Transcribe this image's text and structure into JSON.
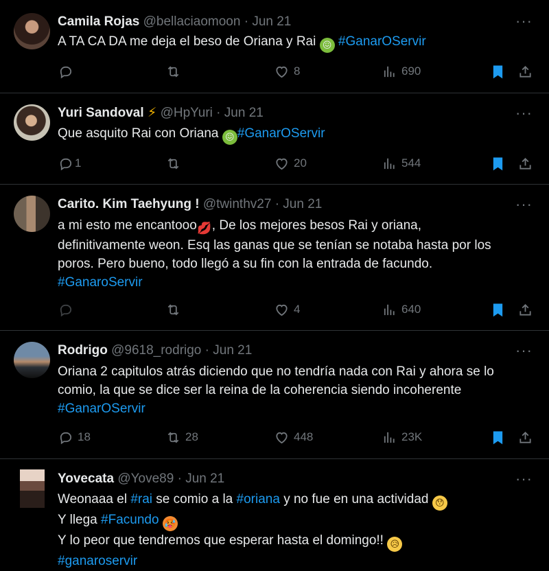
{
  "tweets": [
    {
      "name": "Camila Rojas",
      "badge": "",
      "handle": "@bellaciaomoon",
      "dot": "·",
      "date": "Jun 21",
      "text_a": "A TA CA DA me deja el beso de Oriana y Rai",
      "emoji_a": "nauseated-face",
      "tag_a": "#GanarOServir",
      "replies": "",
      "retweets": "",
      "likes": "8",
      "views": "690"
    },
    {
      "name": "Yuri Sandoval",
      "badge": "⚡",
      "handle": "@HpYuri",
      "dot": "·",
      "date": "Jun 21",
      "text_a": "Que asquito Rai con Oriana",
      "emoji_a": "nauseated-face",
      "tag_a": "#GanarOServir",
      "replies": "1",
      "retweets": "",
      "likes": "20",
      "views": "544"
    },
    {
      "name": "Carito. Kim Taehyung !",
      "badge": "",
      "handle": "@twinthv27",
      "dot": "·",
      "date": "Jun 21",
      "text_a": "a mi esto me encantooo",
      "emoji_a": "kiss-mark",
      "text_b": ", De los mejores besos Rai y oriana,",
      "line_2": "definitivamente weon. Esq las ganas que se tenían se notaba hasta por los",
      "line_3": "poros. Pero bueno, todo llegó a su fin con la entrada de facundo.",
      "tag_a": "#GanaroServir",
      "replies": "",
      "retweets": "",
      "likes": "4",
      "views": "640"
    },
    {
      "name": "Rodrigo",
      "badge": "",
      "handle": "@9618_rodrigo",
      "dot": "·",
      "date": "Jun 21",
      "line_1": "Oriana 2 capitulos atrás diciendo que no tendría nada con Rai y ahora se lo",
      "line_2": "comio, la que se dice ser la reina de la coherencia siendo incoherente",
      "tag_a": "#GanarOServir",
      "replies": "18",
      "retweets": "28",
      "likes": "448",
      "views": "23K"
    },
    {
      "name": "Yovecata",
      "badge": "",
      "handle": "@Yove89",
      "dot": "·",
      "date": "Jun 21",
      "l1_a": "Weonaaa el ",
      "l1_tag1": "#rai",
      "l1_b": " se comio a la ",
      "l1_tag2": "#oriana",
      "l1_c": " y no fue en una actividad",
      "l1_emoji": "hushed-face",
      "l2_a": "Y llega ",
      "l2_tag": "#Facundo",
      "l2_emoji": "hot-face",
      "l3_a": "Y lo peor que tendremos que esperar hasta el domingo!!",
      "l3_emoji": "sad-but-relieved-face",
      "l4_tag": "#ganaroservir"
    }
  ],
  "more_label": "···",
  "colors": {
    "accent": "#1d9bf0",
    "muted": "#71767b",
    "text": "#e7e9ea",
    "divider": "#2f3336",
    "background": "#000000"
  },
  "icons": [
    "reply-icon",
    "retweet-icon",
    "like-icon",
    "views-icon",
    "bookmark-icon",
    "share-icon"
  ]
}
